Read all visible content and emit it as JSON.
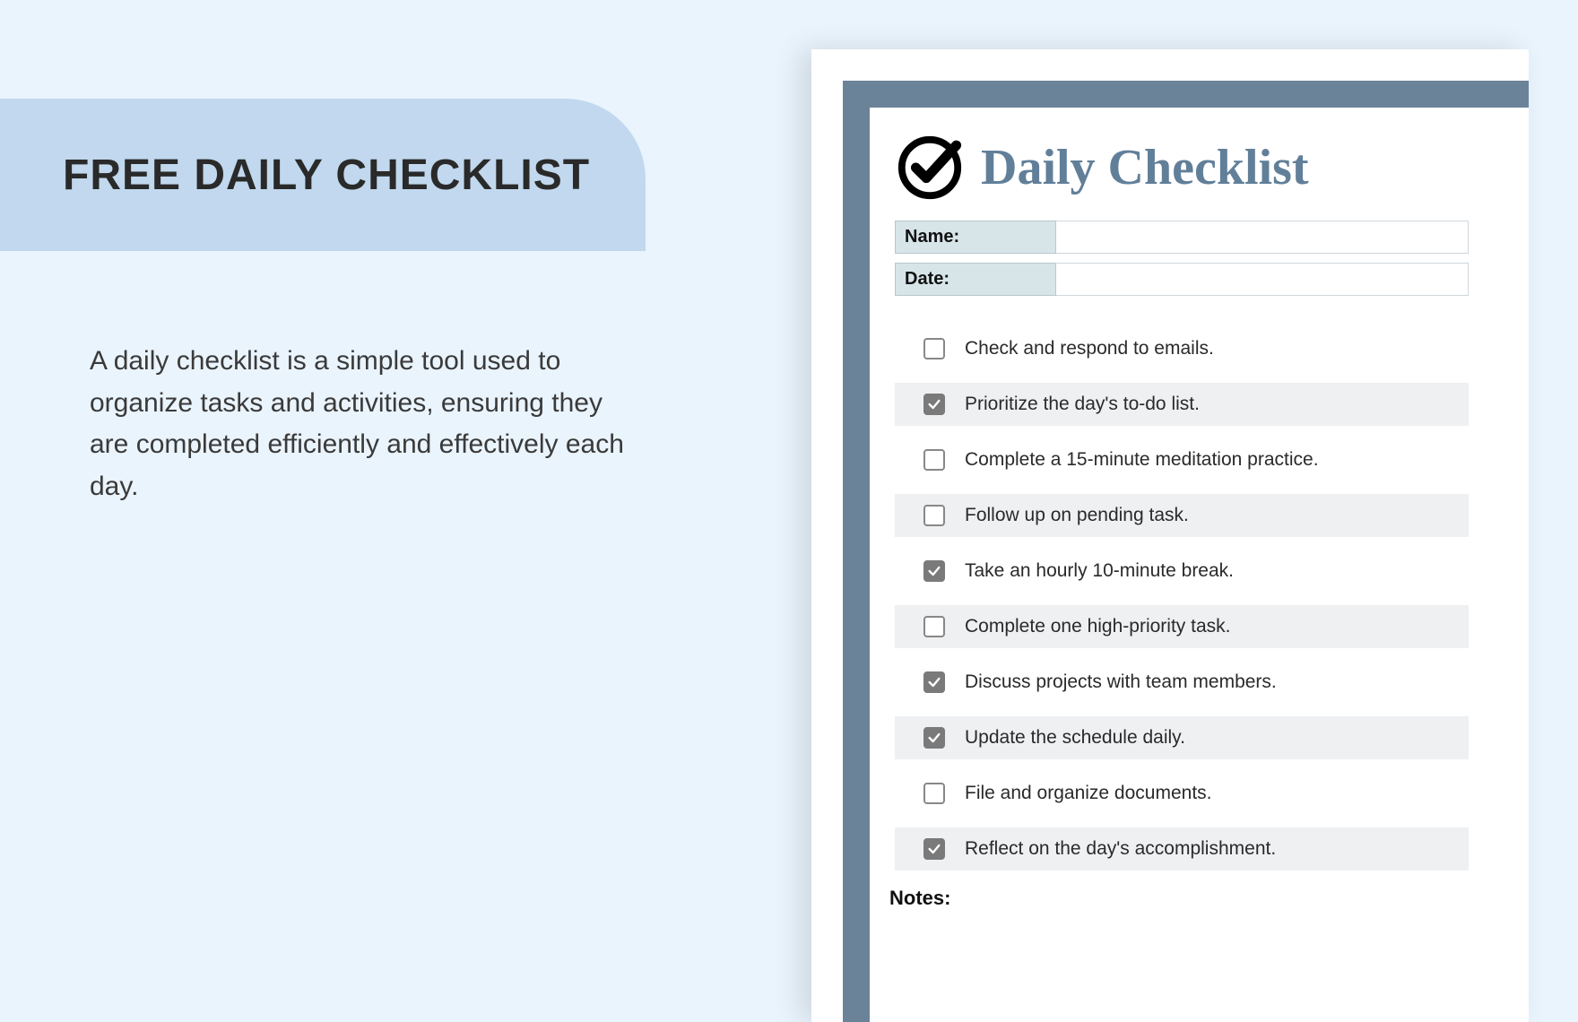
{
  "left": {
    "title": "FREE DAILY CHECKLIST",
    "description": "A daily checklist is a simple tool used to organize tasks and activities, ensuring they are completed efficiently and effectively each day."
  },
  "doc": {
    "title": "Daily Checklist",
    "name_label": "Name:",
    "date_label": "Date:",
    "notes_label": "Notes:",
    "items": [
      {
        "text": "Check and respond to emails.",
        "checked": false
      },
      {
        "text": "Prioritize the day's to-do list.",
        "checked": true
      },
      {
        "text": "Complete a 15-minute meditation practice.",
        "checked": false
      },
      {
        "text": "Follow up on pending task.",
        "checked": false
      },
      {
        "text": "Take an hourly 10-minute break.",
        "checked": true
      },
      {
        "text": "Complete one high-priority task.",
        "checked": false
      },
      {
        "text": "Discuss projects with team members.",
        "checked": true
      },
      {
        "text": "Update the schedule daily.",
        "checked": true
      },
      {
        "text": "File and organize documents.",
        "checked": false
      },
      {
        "text": "Reflect on the day's accomplishment.",
        "checked": true
      }
    ]
  }
}
